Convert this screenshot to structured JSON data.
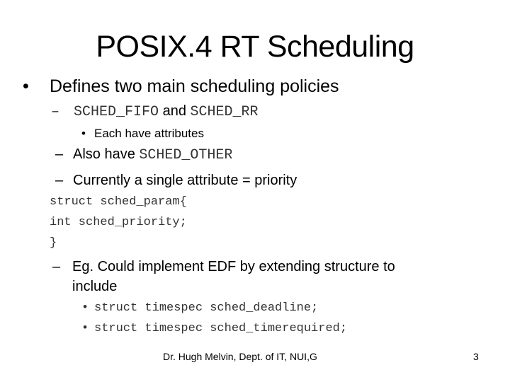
{
  "slide": {
    "title": "POSIX.4 RT Scheduling",
    "items": [
      {
        "level": 1,
        "marker": "•",
        "text": "Defines two main scheduling policies"
      },
      {
        "level": 2,
        "marker": "–",
        "parts": [
          {
            "mono": true,
            "text": "SCHED_FIFO"
          },
          {
            "mono": false,
            "text": " and "
          },
          {
            "mono": true,
            "text": "SCHED_RR"
          }
        ]
      },
      {
        "level": 3,
        "marker": "•",
        "text": "Each have attributes"
      },
      {
        "level": 2,
        "marker": "–",
        "parts": [
          {
            "mono": false,
            "text": "Also have "
          },
          {
            "mono": true,
            "text": "SCHED_OTHER"
          }
        ]
      },
      {
        "level": 2,
        "marker": "–",
        "text": "Currently a single attribute = priority"
      }
    ],
    "code": [
      "struct sched_param{",
      "int sched_priority;",
      "}"
    ],
    "edf": {
      "marker": "–",
      "line1": "Eg. Could implement EDF by extending structure to",
      "line2": "include",
      "subitems": [
        {
          "marker": "•",
          "text": "struct timespec sched_deadline;"
        },
        {
          "marker": "•",
          "text": "struct timespec sched_timerequired;"
        }
      ]
    },
    "footer": {
      "author": "Dr. Hugh Melvin, Dept. of IT, NUI,G",
      "page_number": "3"
    }
  }
}
